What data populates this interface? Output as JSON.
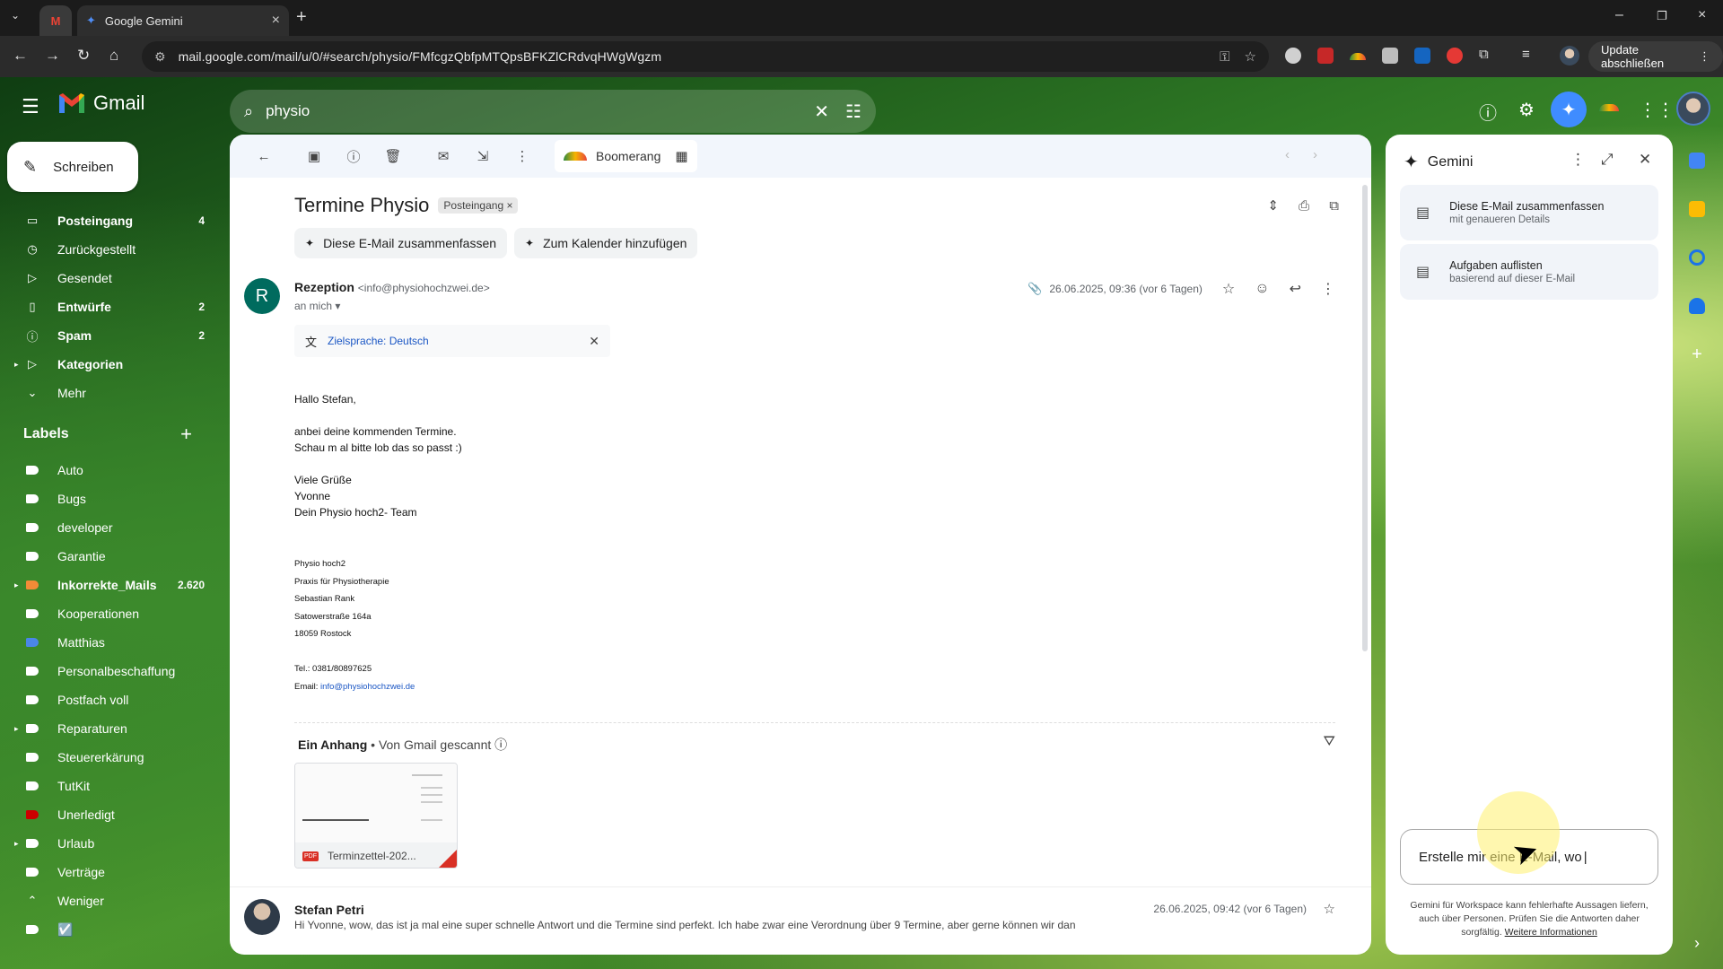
{
  "browser": {
    "tab_title": "Google Gemini",
    "url": "mail.google.com/mail/u/0/#search/physio/FMfcgzQbfpMTQpsBFKZlCRdvqHWgWgzm",
    "update_label": "Update abschließen",
    "icons": [
      "back-icon",
      "forward-icon",
      "reload-icon",
      "home-icon",
      "tune-icon",
      "password-key-icon",
      "bookmark-star-icon"
    ]
  },
  "header": {
    "app_name": "Gmail",
    "search_query": "physio",
    "icons": [
      "menu-icon",
      "search-icon",
      "clear-icon",
      "filter-icon",
      "help-icon",
      "settings-icon",
      "gemini-icon",
      "apps-icon"
    ]
  },
  "sidebar": {
    "compose_label": "Schreiben",
    "items": [
      {
        "label": "Posteingang",
        "count": "4",
        "bold": true,
        "icon": "inbox-icon"
      },
      {
        "label": "Zurückgestellt",
        "count": "",
        "bold": false,
        "icon": "clock-icon"
      },
      {
        "label": "Gesendet",
        "count": "",
        "bold": false,
        "icon": "send-icon"
      },
      {
        "label": "Entwürfe",
        "count": "2",
        "bold": true,
        "icon": "draft-icon"
      },
      {
        "label": "Spam",
        "count": "2",
        "bold": true,
        "icon": "spam-icon"
      },
      {
        "label": "Kategorien",
        "count": "",
        "bold": true,
        "icon": "label-outline-icon"
      },
      {
        "label": "Mehr",
        "count": "",
        "bold": false,
        "icon": "chevron-down-icon"
      }
    ],
    "labels_title": "Labels",
    "labels": [
      {
        "label": "Auto",
        "count": "",
        "color": "#ffffff"
      },
      {
        "label": "Bugs",
        "count": "",
        "color": "#ffffff"
      },
      {
        "label": "developer",
        "count": "",
        "color": "#ffffff"
      },
      {
        "label": "Garantie",
        "count": "",
        "color": "#ffffff"
      },
      {
        "label": "Inkorrekte_Mails",
        "count": "2.620",
        "color": "#f28b37",
        "bold": true
      },
      {
        "label": "Kooperationen",
        "count": "",
        "color": "#ffffff"
      },
      {
        "label": "Matthias",
        "count": "",
        "color": "#4a86e8"
      },
      {
        "label": "Personalbeschaffung",
        "count": "",
        "color": "#ffffff"
      },
      {
        "label": "Postfach voll",
        "count": "",
        "color": "#ffffff"
      },
      {
        "label": "Reparaturen",
        "count": "",
        "color": "#ffffff"
      },
      {
        "label": "Steuererkärung",
        "count": "",
        "color": "#ffffff"
      },
      {
        "label": "TutKit",
        "count": "",
        "color": "#ffffff"
      },
      {
        "label": "Unerledigt",
        "count": "",
        "color": "#cc0000"
      },
      {
        "label": "Urlaub",
        "count": "",
        "color": "#ffffff"
      },
      {
        "label": "Verträge",
        "count": "",
        "color": "#ffffff"
      },
      {
        "label": "Weniger",
        "count": "",
        "color": "",
        "icon": "chevron-up-icon"
      },
      {
        "label": "☑️",
        "count": "",
        "color": "#ffffff"
      }
    ]
  },
  "mail": {
    "toolbar_boomerang": "Boomerang",
    "subject": "Termine Physio",
    "inbox_chip": "Posteingang",
    "quick_actions": [
      "Diese E-Mail zusammenfassen",
      "Zum Kalender hinzufügen"
    ],
    "sender_initial": "R",
    "sender_name": "Rezeption",
    "sender_email": "<info@physiohochzwei.de>",
    "recipient": "an mich",
    "date": "26.06.2025, 09:36 (vor 6 Tagen)",
    "translate_label": "Zielsprache: Deutsch",
    "body": {
      "greeting": "Hallo Stefan,",
      "line1": "anbei deine kommenden Termine.",
      "line2": "Schau m al bitte lob das so passt :)",
      "closing1": "Viele Grüße",
      "closing2": "Yvonne",
      "closing3": "Dein Physio hoch2- Team"
    },
    "signature": {
      "l1": "Physio hoch2",
      "l2": "Praxis für Physiotherapie",
      "l3": "Sebastian Rank",
      "l4": "Satowerstraße 164a",
      "l5": "18059 Rostock",
      "tel": "Tel.: 0381/80897625",
      "email_label": "Email:",
      "email_link": "info@physiohochzwei.de"
    },
    "attachment_title": "Ein Anhang",
    "attachment_scan": "• Von Gmail gescannt",
    "attachment_name": "Terminzettel-202...",
    "attachment_badge": "PDF",
    "second_message": {
      "name": "Stefan Petri",
      "date": "26.06.2025, 09:42 (vor 6 Tagen)",
      "snippet": "Hi Yvonne, wow, das ist ja mal eine super schnelle Antwort und die Termine sind perfekt. Ich habe zwar eine Verordnung über 9 Termine, aber gerne können wir dan"
    }
  },
  "gemini": {
    "title": "Gemini",
    "cards": [
      {
        "title": "Diese E-Mail zusammenfassen",
        "sub": "mit genaueren Details"
      },
      {
        "title": "Aufgaben auflisten",
        "sub": "basierend auf dieser E-Mail"
      }
    ],
    "input_value": "Erstelle mir eine E-Mail, wo",
    "disclaimer": "Gemini für Workspace kann fehlerhafte Aussagen liefern, auch über Personen. Prüfen Sie die Antworten daher sorgfältig.",
    "more_link": "Weitere Informationen"
  },
  "colors": {
    "accent_blue": "#3f8cff",
    "card_bg": "#ffffff",
    "toolbar_bg": "#f2f6fc"
  }
}
